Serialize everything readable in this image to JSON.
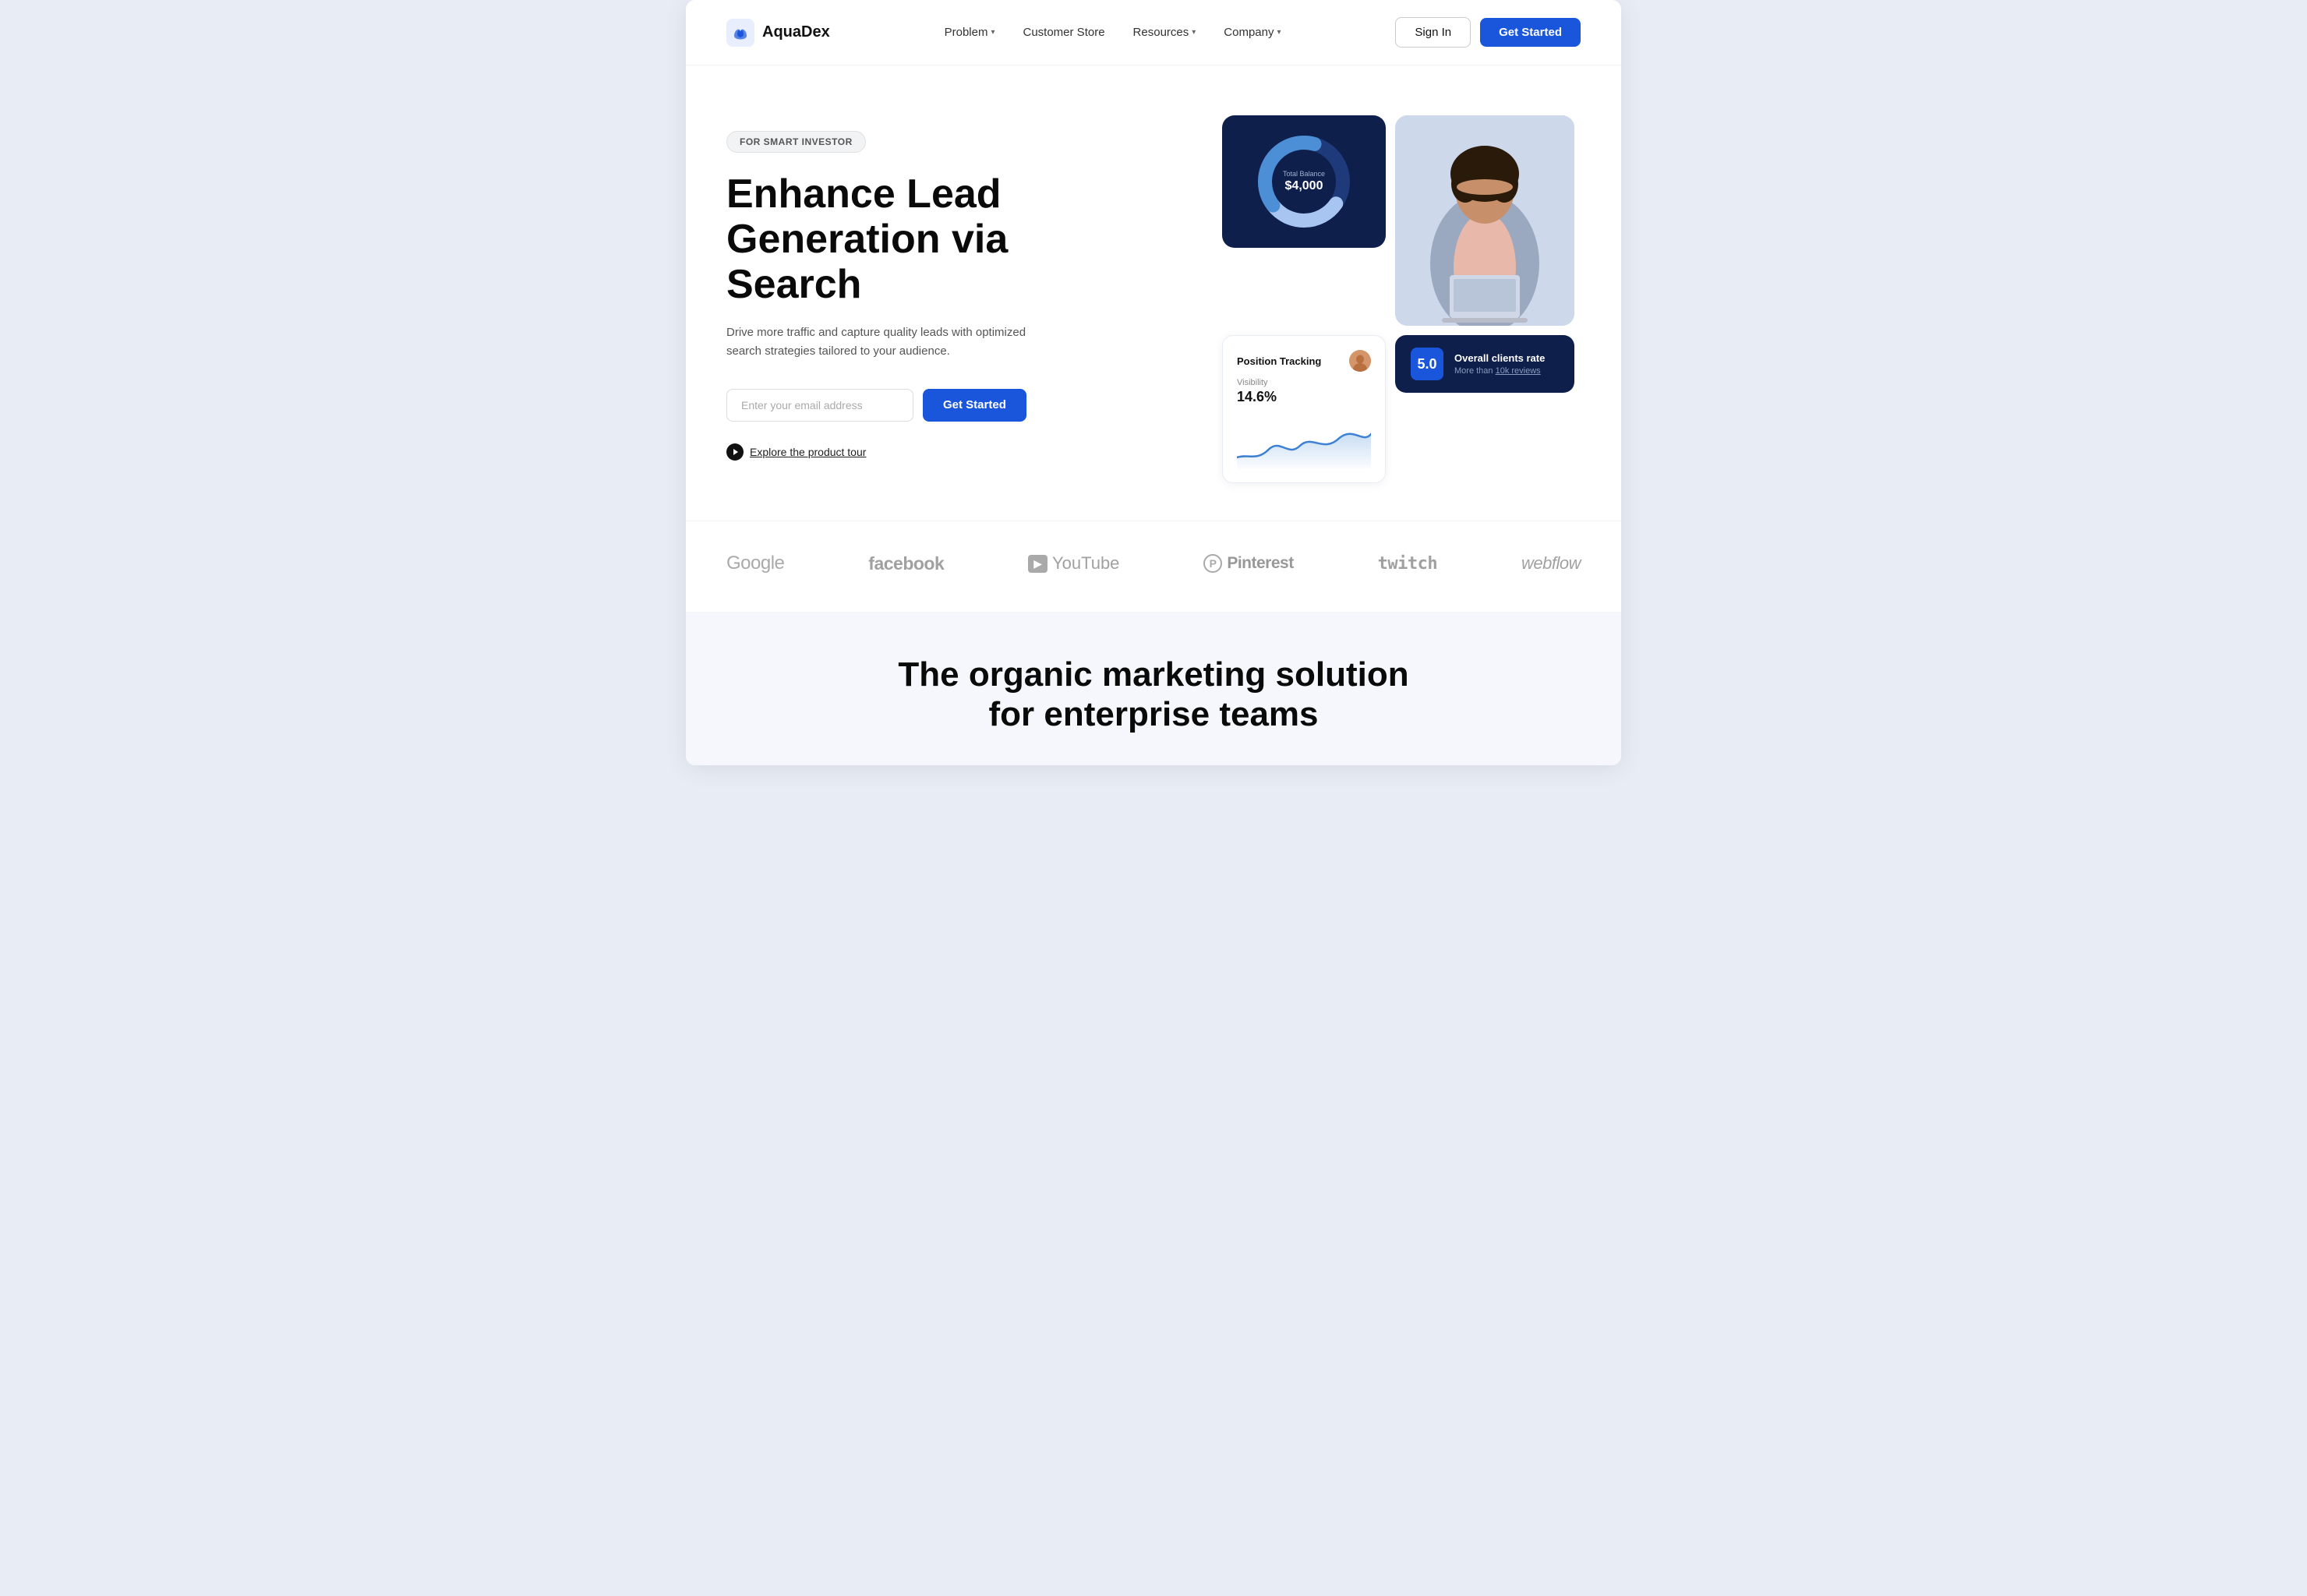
{
  "logo": {
    "text": "AquaDex"
  },
  "nav": {
    "links": [
      {
        "label": "Problem",
        "hasDropdown": true
      },
      {
        "label": "Customer Store",
        "hasDropdown": false
      },
      {
        "label": "Resources",
        "hasDropdown": true
      },
      {
        "label": "Company",
        "hasDropdown": true
      }
    ],
    "signin_label": "Sign In",
    "getstarted_label": "Get Started"
  },
  "hero": {
    "badge": "FOR SMART INVESTOR",
    "title": "Enhance Lead Generation via Search",
    "description": "Drive more traffic and capture quality leads with optimized search strategies tailored to your audience.",
    "email_placeholder": "Enter your email address",
    "cta_label": "Get Started",
    "tour_link": "Explore the product tour"
  },
  "balance_card": {
    "label": "Total Balance",
    "value": "$4,000"
  },
  "tracking_card": {
    "title": "Position Tracking",
    "visibility_label": "Visibility",
    "visibility_value": "14.6%"
  },
  "rating_card": {
    "score": "5.0",
    "title": "Overall clients rate",
    "subtitle": "More than",
    "link_text": "10k reviews"
  },
  "brands": [
    {
      "name": "Google",
      "type": "google"
    },
    {
      "name": "facebook",
      "type": "facebook"
    },
    {
      "name": "YouTube",
      "type": "youtube"
    },
    {
      "name": "Pinterest",
      "type": "pinterest"
    },
    {
      "name": "twitch",
      "type": "twitch"
    },
    {
      "name": "webflow",
      "type": "webflow"
    }
  ],
  "bottom": {
    "title_line1": "The organic marketing solution",
    "title_line2": "for enterprise teams"
  }
}
